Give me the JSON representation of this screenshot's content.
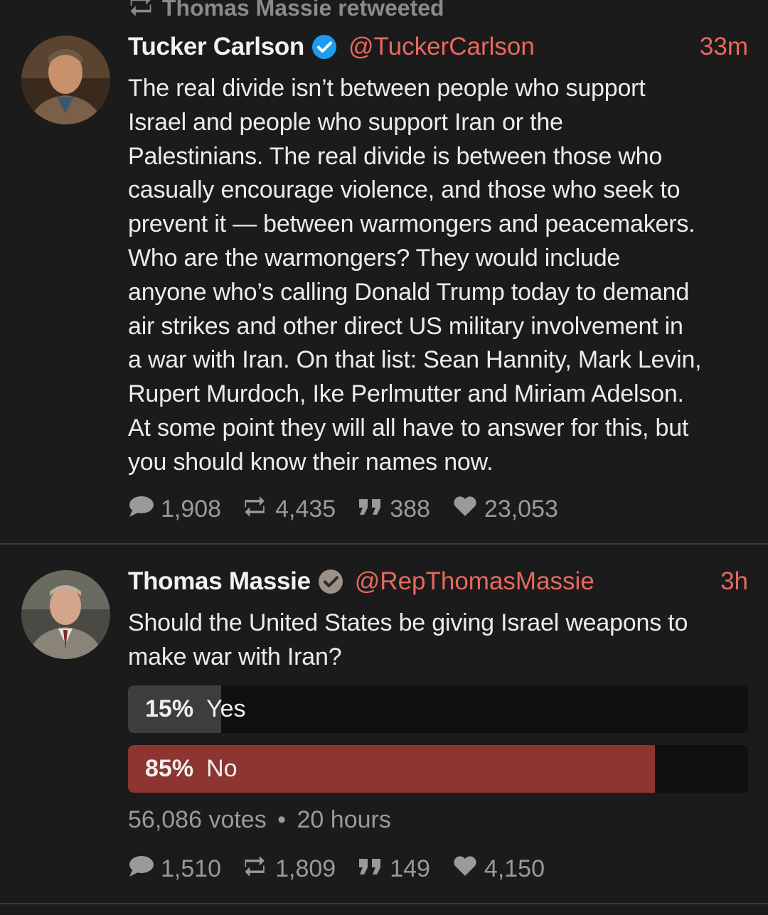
{
  "retweet_banner": {
    "text": "Thomas Massie retweeted"
  },
  "tweets": [
    {
      "name": "Tucker Carlson",
      "handle": "@TuckerCarlson",
      "time": "33m",
      "verified_badge": "blue-check",
      "lines": [
        "The real divide isn’t between people who support",
        "Israel and people who support Iran or the",
        "Palestinians. The real divide is between those who",
        "casually encourage violence, and those who seek to",
        "prevent it — between warmongers and peacemakers.",
        "Who are the warmongers? They would include",
        "anyone who’s calling Donald Trump today to demand",
        "air strikes and other direct US military involvement in",
        "a war with Iran. On that list: Sean Hannity, Mark Levin,",
        "Rupert Murdoch, Ike Perlmutter and Miriam Adelson.",
        "At some point they will all have to answer for this, but",
        "you should know their names now."
      ],
      "stats": {
        "replies": "1,908",
        "retweets": "4,435",
        "quotes": "388",
        "likes": "23,053"
      }
    },
    {
      "name": "Thomas Massie",
      "handle": "@RepThomasMassie",
      "time": "3h",
      "verified_badge": "gray-check",
      "lines": [
        "Should the United States be giving Israel weapons to",
        "make war with Iran?"
      ],
      "poll": {
        "options": [
          {
            "percent_label": "15%",
            "label": "Yes",
            "fraction": 0.15,
            "color": "#3d3d3d"
          },
          {
            "percent_label": "85%",
            "label": "No",
            "fraction": 0.85,
            "color": "#8e3431"
          }
        ],
        "votes": "56,086 votes",
        "duration": "20 hours",
        "separator": "•"
      },
      "stats": {
        "replies": "1,510",
        "retweets": "1,809",
        "quotes": "149",
        "likes": "4,150"
      }
    }
  ],
  "colors": {
    "background": "#1b1b1b",
    "accent": "#e8685e",
    "muted": "#9a9a9a",
    "verified_blue": "#1d9bf0"
  },
  "icons": [
    "retweet-icon",
    "reply-icon",
    "quote-icon",
    "like-icon",
    "verified-badge-icon"
  ]
}
